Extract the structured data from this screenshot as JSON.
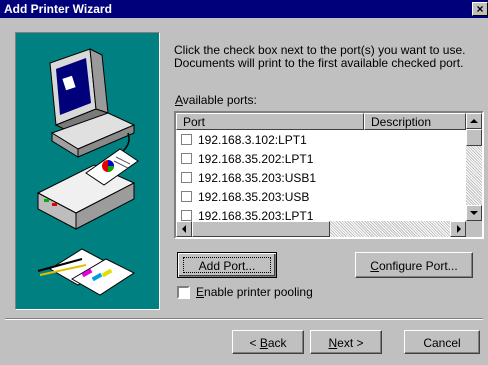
{
  "window": {
    "title": "Add Printer Wizard",
    "close_glyph": "×"
  },
  "instructions": {
    "line1": "Click the check box next to the port(s) you want to use.",
    "line2": "Documents will print to the first available checked port."
  },
  "ports_label": {
    "mnemonic": "A",
    "rest": "vailable ports:"
  },
  "ports_list": {
    "columns": [
      "Port",
      "Description"
    ],
    "rows": [
      {
        "port": "192.168.3.102:LPT1",
        "checked": false
      },
      {
        "port": "192.168.35.202:LPT1",
        "checked": false
      },
      {
        "port": "192.168.35.203:USB1",
        "checked": false
      },
      {
        "port": "192.168.35.203:USB",
        "checked": false
      },
      {
        "port": "192.168.35.203:LPT1",
        "checked": false
      }
    ]
  },
  "buttons": {
    "add_port": "Add Port...",
    "configure_port": {
      "mnemonic": "C",
      "rest": "onfigure Port..."
    },
    "back": {
      "prefix": "< ",
      "mnemonic": "B",
      "rest": "ack"
    },
    "next": {
      "mnemonic": "N",
      "rest": "ext >"
    },
    "cancel": "Cancel"
  },
  "pooling": {
    "mnemonic": "E",
    "rest": "nable printer pooling",
    "checked": false
  },
  "icons": [
    "close-icon",
    "computer-printer-illustration",
    "scroll-up-icon",
    "scroll-down-icon",
    "scroll-left-icon",
    "scroll-right-icon"
  ]
}
